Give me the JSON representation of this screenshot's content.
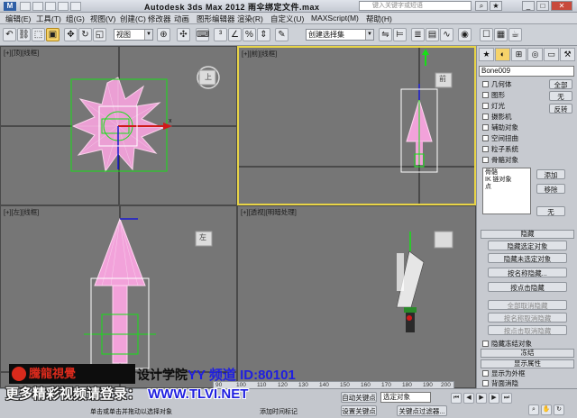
{
  "window": {
    "title": "Autodesk 3ds Max  2012    雨伞绑定文件.max",
    "search_placeholder": "键入关键字或短语",
    "app_icon": "3ds-max-logo"
  },
  "menu": [
    "编辑(E)",
    "工具(T)",
    "组(G)",
    "视图(V)",
    "创建(C)",
    "修改器",
    "动画",
    "图形编辑器",
    "渲染(R)",
    "自定义(U)",
    "MAXScript(M)",
    "帮助(H)"
  ],
  "toolbar": {
    "view_combo": "视图",
    "selection_set_combo": "创建选择集"
  },
  "viewports": {
    "top": "[+][顶][线框]",
    "front": "[+][前][线框]",
    "left": "[+][左][线框]",
    "perspective": "[+][透视][明暗处理]",
    "viewcube_top": "上",
    "viewcube_front": "前",
    "viewcube_left": "左"
  },
  "panel": {
    "name_field": "Bone009",
    "checkboxes": [
      "几何体",
      "图形",
      "灯光",
      "摄影机",
      "辅助对象",
      "空间扭曲",
      "粒子系统",
      "骨骼对象"
    ],
    "buttons_right": [
      "全部",
      "无",
      "反转"
    ],
    "list_items": [
      "骨骼",
      "IK 链对象",
      "点"
    ],
    "list_buttons": [
      "添加",
      "移除",
      "无"
    ],
    "hide_rollout": "隐藏",
    "hide_buttons": [
      "隐藏选定对象",
      "隐藏未选定对象",
      "按名称隐藏...",
      "按点击隐藏",
      "全部取消隐藏",
      "按名称取消隐藏",
      "按点击取消隐藏"
    ],
    "hide_frozen": "隐藏冻结对象",
    "freeze_rollout": "冻结",
    "display_props_rollout": "显示属性",
    "display_props": [
      "显示为外框",
      "背面消隐"
    ]
  },
  "timeline": {
    "ticks": [
      "90",
      "100",
      "110",
      "120",
      "130",
      "140",
      "150",
      "160",
      "170",
      "180",
      "190",
      "200"
    ]
  },
  "bottom": {
    "auto_key": "自动关键点",
    "set_key": "设置关键点",
    "selected_combo": "选定对象",
    "key_filter": "关键点过滤器...",
    "status": "单击或单击并拖动以选择对象",
    "add_time_tag": "添加时间标记"
  },
  "watermark": {
    "logo": "騰龍視覺",
    "academy": "设计学院",
    "yy": "YY 频道 ID:80101",
    "more": "更多精彩视频请登录：",
    "url": "WWW.TLVI.NET"
  },
  "colors": {
    "viewport_bg": "#767676",
    "active_border": "#e8d447",
    "umbrella_pink": "#f0a0d8",
    "bone_green": "#16e016"
  }
}
